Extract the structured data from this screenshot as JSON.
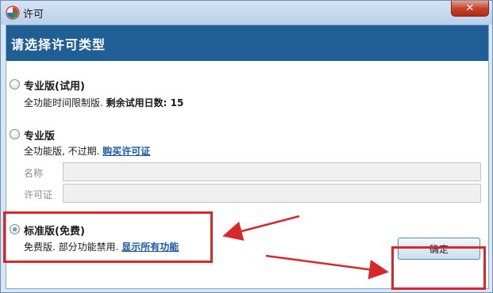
{
  "window": {
    "title": "许可",
    "close_symbol": "✕"
  },
  "header": {
    "title": "请选择许可类型"
  },
  "options": [
    {
      "label": "专业版(试用)",
      "desc_prefix": "全功能时间限制版.",
      "desc_bold": "剩余试用日数: 15",
      "selected": false
    },
    {
      "label": "专业版",
      "desc_prefix": "全功能版, 不过期.",
      "link": "购买许可证",
      "selected": false
    },
    {
      "label": "标准版(免费)",
      "desc_prefix": "免费版. 部分功能禁用.",
      "link": "显示所有功能",
      "selected": true
    }
  ],
  "license_form": {
    "name_label": "名称",
    "name_value": "",
    "license_label": "许可证",
    "license_value": ""
  },
  "buttons": {
    "ok_label": "确定"
  },
  "annotation_color": "#d8282a",
  "icons": {
    "app": "app-logo-icon",
    "close": "close-icon"
  }
}
